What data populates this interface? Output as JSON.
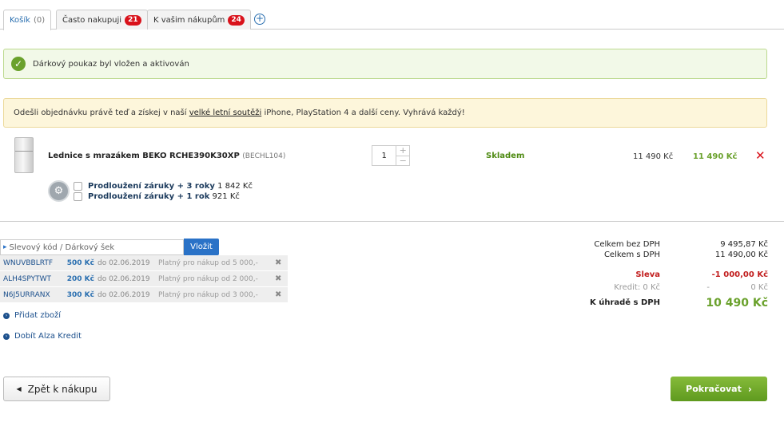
{
  "tabs": [
    {
      "label": "Košík",
      "count": "(0)"
    },
    {
      "label": "Často nakupuji",
      "badge": "21"
    },
    {
      "label": "K vašim nákupům",
      "badge": "24"
    }
  ],
  "tab_add": "+",
  "alert_success": "Dárkový poukaz byl vložen a aktivován",
  "promo": {
    "before": "Odešli objednávku právě teď a získej v naší ",
    "link": "velké letní soutěži",
    "after": " iPhone, PlayStation 4 a další ceny. Vyhrává každý!"
  },
  "product": {
    "name": "Lednice s mrazákem BEKO RCHE390K30XP",
    "code": "(BECHL104)",
    "qty": "1",
    "stock": "Skladem",
    "unit_price": "11 490 Kč",
    "total_price": "11 490 Kč",
    "remove": "✕"
  },
  "warranties": [
    {
      "label": "Prodloužení záruky + 3 roky",
      "price": "1 842 Kč"
    },
    {
      "label": "Prodloužení záruky + 1 rok",
      "price": "921 Kč"
    }
  ],
  "voucher": {
    "placeholder": "Slevový kód / Dárkový šek",
    "button": "Vložit",
    "items": [
      {
        "code": "WNUVBBLRTF",
        "value": "500 Kč",
        "date": "do 02.06.2019",
        "note": "Platný pro nákup od 5 000,-"
      },
      {
        "code": "ALH4SPYTWT",
        "value": "200 Kč",
        "date": "do 02.06.2019",
        "note": "Platný pro nákup od 2 000,-"
      },
      {
        "code": "N6J5URRANX",
        "value": "300 Kč",
        "date": "do 02.06.2019",
        "note": "Platný pro nákup od 3 000,-"
      }
    ],
    "delete": "✖"
  },
  "links": {
    "add_item": "Přidat zboží",
    "top_up": "Dobít Alza Kredit"
  },
  "summary": {
    "without_vat_label": "Celkem bez DPH",
    "without_vat": "9 495,87 Kč",
    "with_vat_label": "Celkem s DPH",
    "with_vat": "11 490,00 Kč",
    "discount_label": "Sleva",
    "discount": "-1 000,00 Kč",
    "credit_label": "Kredit: 0 Kč",
    "credit_dash": "-",
    "credit": "0 Kč",
    "total_label": "K úhradě s DPH",
    "total": "10 490 Kč"
  },
  "buttons": {
    "back": "Zpět k nákupu",
    "continue": "Pokračovat"
  },
  "colors": {
    "accent_green": "#6aa12c",
    "link_blue": "#1b4f8c",
    "danger": "#d9121b"
  }
}
